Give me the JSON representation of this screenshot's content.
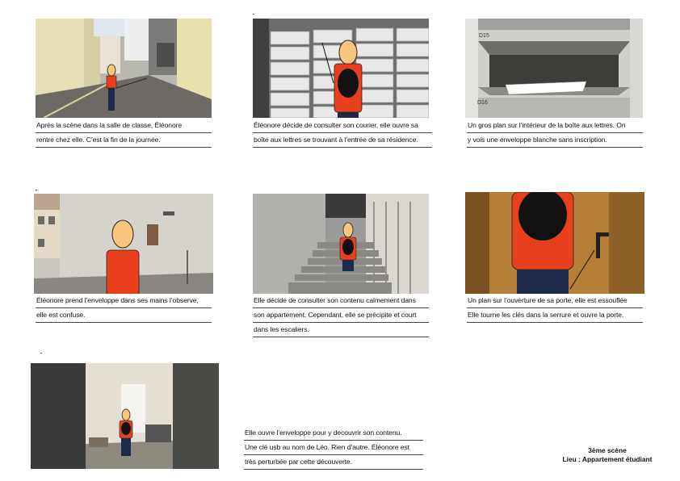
{
  "panels": [
    {
      "id": 1,
      "caption": [
        "Après la scène dans la salle de classe, Éléonore",
        "rentre chez elle. C’est la fin de la journée."
      ]
    },
    {
      "id": 2,
      "caption": [
        "Éléonore décide de consulter son courier, elle ouvre sa",
        "boîte aux lettres se trouvant à l’entrée de sa résidence."
      ]
    },
    {
      "id": 3,
      "caption": [
        "Un gros plan sur l’intérieur de la boîte aux lettres. On",
        "y vois une enveloppe blanche sans inscription."
      ],
      "labels": [
        "D15",
        "D16"
      ]
    },
    {
      "id": 4,
      "caption": [
        "Éléonore prend l’enveloppe dans ses mains l’observe,",
        "elle est confuse."
      ]
    },
    {
      "id": 5,
      "caption": [
        "Elle décide de consulter son contenu calmement dans",
        "son appartement. Cependant, elle se précipite et court",
        "dans les escaliers."
      ]
    },
    {
      "id": 6,
      "caption": [
        "Un plan sur l’ouverture de sa porte, elle est essouflée",
        "Elle tourne les clés dans la serrure et ouvre la porte."
      ]
    },
    {
      "id": 7,
      "caption": [
        "Elle ouvre l’enveloppe pour y decouvrir son contenu.",
        "Une clé usb au nom de Léo. Rien d’autre. Éléonore est",
        "très perturbée par cette découverte."
      ]
    }
  ],
  "scene": {
    "title": "3ème scène",
    "place": "Lieu : Appartement étudiant"
  },
  "colors": {
    "shirt": "#e8401c",
    "skin": "#f6c57e",
    "hair": "#111111",
    "pants": "#1e2a4a"
  }
}
